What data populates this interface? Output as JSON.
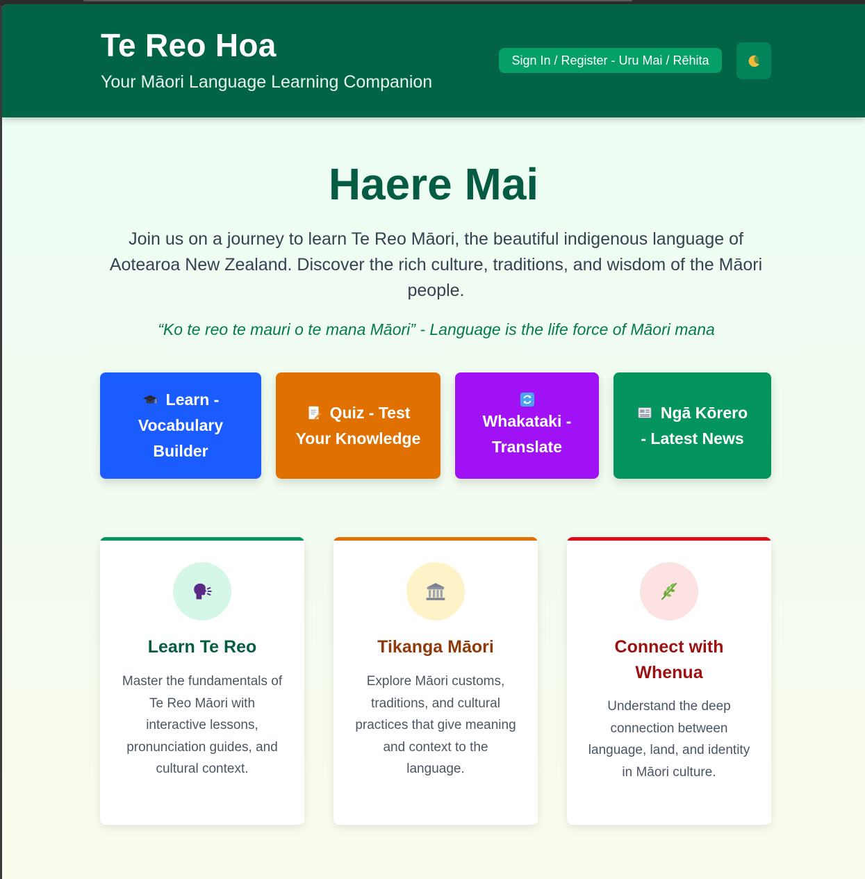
{
  "header": {
    "title": "Te Reo Hoa",
    "subtitle": "Your Māori Language Learning Companion",
    "signin_label": "Sign In / Register - Uru Mai / Rēhita",
    "theme_toggle_icon": "moon-icon"
  },
  "hero": {
    "title": "Haere Mai",
    "intro": "Join us on a journey to learn Te Reo Māori, the beautiful indigenous language of Aotearoa New Zealand. Discover the rich culture, traditions, and wisdom of the Māori people.",
    "quote": "“Ko te reo te mauri o te mana Māori” - Language is the life force of Māori mana"
  },
  "actions": [
    {
      "label": "Learn - Vocabulary Builder",
      "icon": "graduation-cap-icon",
      "color": "#1a5cff"
    },
    {
      "label": "Quiz - Test Your Knowledge",
      "icon": "memo-icon",
      "color": "#e07000"
    },
    {
      "label": "Whakataki - Translate",
      "icon": "refresh-icon",
      "color": "#a111f5"
    },
    {
      "label": "Ngā Kōrero - Latest News",
      "icon": "newspaper-icon",
      "color": "#04955f"
    }
  ],
  "cards": [
    {
      "title": "Learn Te Reo",
      "text": "Master the fundamentals of Te Reo Māori with interactive lessons, pronunciation guides, and cultural context.",
      "icon": "speaking-head-icon",
      "accent": "#04955f",
      "title_color": "#065c42",
      "icon_bg": "#d5f7e7"
    },
    {
      "title": "Tikanga Māori",
      "text": "Explore Māori customs, traditions, and cultural practices that give meaning and context to the language.",
      "icon": "classical-building-icon",
      "accent": "#e07000",
      "title_color": "#8f3a0b",
      "icon_bg": "#fdf2c8"
    },
    {
      "title": "Connect with Whenua",
      "text": "Understand the deep connection between language, land, and identity in Māori culture.",
      "icon": "herb-icon",
      "accent": "#dc0a17",
      "title_color": "#9b1111",
      "icon_bg": "#fde2e2"
    }
  ]
}
